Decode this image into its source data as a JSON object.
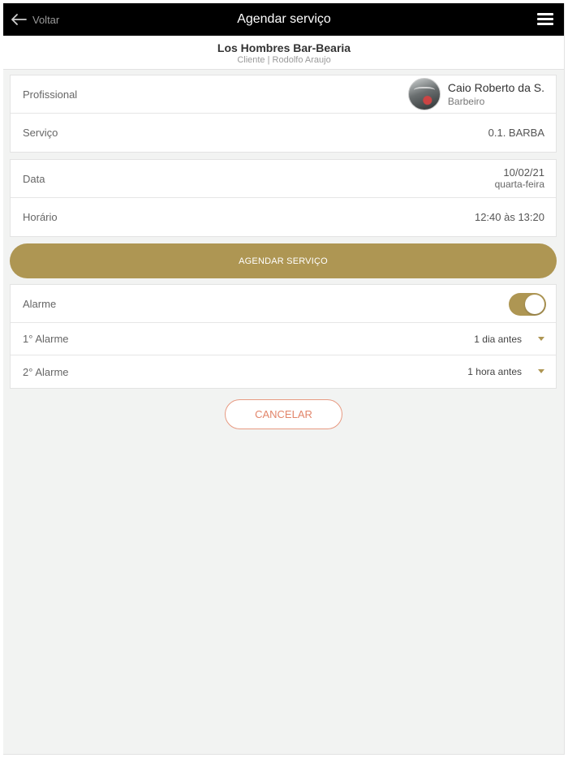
{
  "header": {
    "back_label": "Voltar",
    "title": "Agendar serviço"
  },
  "shop": {
    "name": "Los Hombres Bar-Bearia",
    "subtitle": "Cliente | Rodolfo Araujo"
  },
  "booking": {
    "professional_label": "Profissional",
    "professional_name": "Caio Roberto da S.",
    "professional_role": "Barbeiro",
    "service_label": "Serviço",
    "service_value": "0.1. BARBA",
    "date_label": "Data",
    "date_value": "10/02/21",
    "date_weekday": "quarta-feira",
    "time_label": "Horário",
    "time_value": "12:40 às 13:20"
  },
  "schedule_button_label": "AGENDAR SERVIÇO",
  "alarms": {
    "alarm_label": "Alarme",
    "alarm_enabled": true,
    "first_label": "1° Alarme",
    "first_value": "1 dia antes",
    "second_label": "2° Alarme",
    "second_value": "1 hora antes"
  },
  "cancel_button_label": "CANCELAR",
  "colors": {
    "accent": "#ae9653",
    "cancel": "#e2856a",
    "topbar": "#000000"
  },
  "icons": {
    "back": "arrow-left-icon",
    "menu": "hamburger-menu-icon",
    "dropdown": "caret-down-icon"
  }
}
